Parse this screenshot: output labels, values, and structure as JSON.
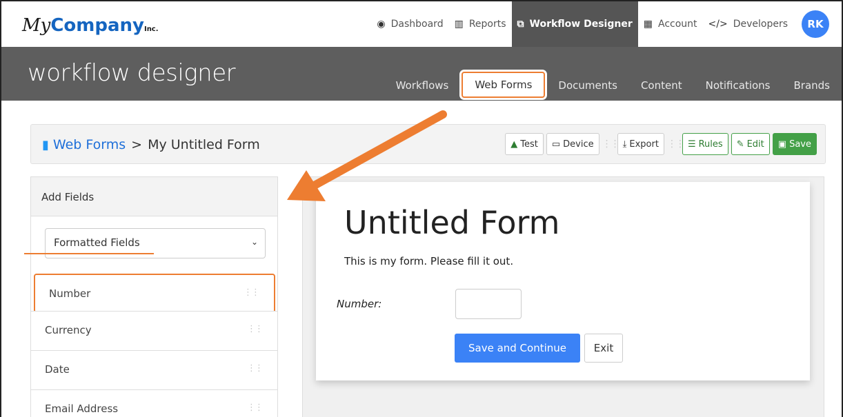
{
  "brand": {
    "my": "My",
    "company": "Company",
    "inc": "Inc."
  },
  "topnav": {
    "items": [
      {
        "icon": "dashboard-icon",
        "glyph": "◉",
        "label": "Dashboard"
      },
      {
        "icon": "reports-icon",
        "glyph": "▥",
        "label": "Reports"
      },
      {
        "icon": "workflow-icon",
        "glyph": "⧉",
        "label": "Workflow Designer"
      },
      {
        "icon": "building-icon",
        "glyph": "▦",
        "label": "Account"
      },
      {
        "icon": "code-icon",
        "glyph": "</>",
        "label": "Developers"
      }
    ],
    "active_index": 2,
    "avatar": "RK"
  },
  "subbar": {
    "title": "workflow designer",
    "tabs": [
      "Workflows",
      "Web Forms",
      "Documents",
      "Content",
      "Notifications",
      "Brands"
    ],
    "active_tab": "Web Forms"
  },
  "breadcrumb": {
    "root": "Web Forms",
    "separator": ">",
    "current": "My Untitled Form"
  },
  "toolbar": {
    "test": "Test",
    "device": "Device",
    "export": "Export",
    "rules": "Rules",
    "edit": "Edit",
    "save": "Save"
  },
  "add_fields": {
    "heading": "Add Fields",
    "category": "Formatted Fields",
    "items": [
      "Number",
      "Currency",
      "Date",
      "Email Address"
    ],
    "highlighted": "Number"
  },
  "form": {
    "title": "Untitled Form",
    "description": "This is my form. Please fill it out.",
    "field_label": "Number:",
    "field_value": "",
    "submit_label": "Save and Continue",
    "exit_label": "Exit"
  },
  "colors": {
    "accent": "#ed7d31",
    "primary": "#3b82f6",
    "save_green": "#43a047",
    "header_gray": "#5e5e5e",
    "link_blue": "#1e6fd9"
  }
}
